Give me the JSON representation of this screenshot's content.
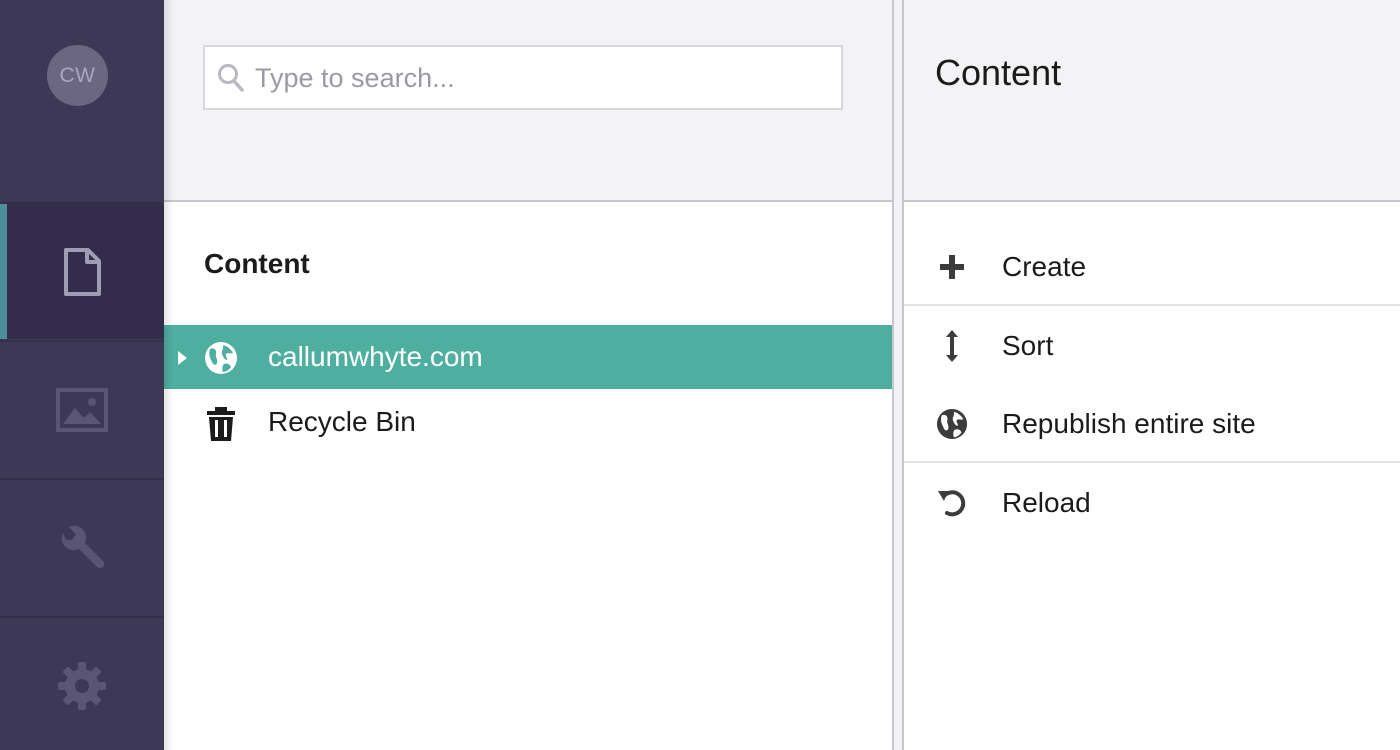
{
  "user": {
    "initials": "CW"
  },
  "nav": {
    "items": [
      {
        "name": "content",
        "icon": "document-icon",
        "active": true
      },
      {
        "name": "media",
        "icon": "image-icon",
        "active": false
      },
      {
        "name": "developer",
        "icon": "wrench-icon",
        "active": false
      },
      {
        "name": "settings",
        "icon": "gear-icon",
        "active": false
      }
    ]
  },
  "search": {
    "placeholder": "Type to search...",
    "value": ""
  },
  "tree": {
    "title": "Content",
    "nodes": [
      {
        "label": "callumwhyte.com",
        "icon": "globe-icon",
        "selected": true,
        "expandable": true
      },
      {
        "label": "Recycle Bin",
        "icon": "trash-icon",
        "selected": false,
        "expandable": false
      }
    ]
  },
  "actions_panel": {
    "title": "Content",
    "items": [
      {
        "label": "Create",
        "icon": "plus-icon"
      },
      {
        "label": "Sort",
        "icon": "sort-arrows-icon"
      },
      {
        "label": "Republish entire site",
        "icon": "globe-icon"
      },
      {
        "label": "Reload",
        "icon": "reload-icon"
      }
    ]
  },
  "colors": {
    "rail": "#3e3857",
    "rail_active": "#332d4b",
    "rail_indicator": "#4d8f99",
    "selected_node": "#4eaea0",
    "header_bg": "#f3f3f5"
  }
}
